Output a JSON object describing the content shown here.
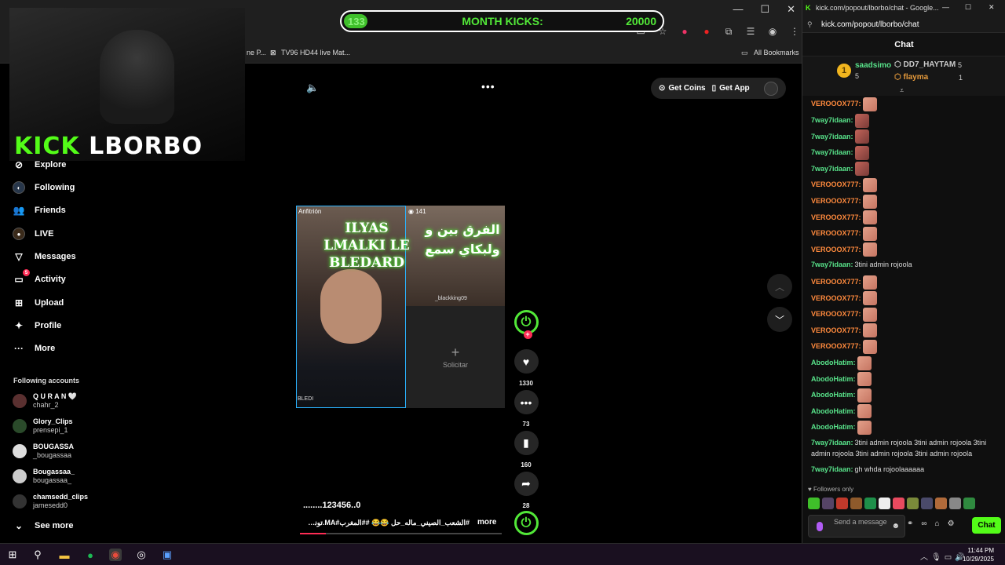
{
  "browser": {
    "bookmarks": [
      "ne P...",
      "TV96 HD44 live Mat...",
      "All Bookmarks"
    ],
    "window_controls": [
      "—",
      "☐",
      "✕"
    ]
  },
  "kick_counter": {
    "current": "133",
    "label": "MONTH KICKS:",
    "goal": "20000",
    "progress_fraction": 0.0067
  },
  "stream_logo": {
    "kick": "KICK",
    "name": "LBORBO"
  },
  "sidebar": {
    "items": [
      {
        "label": "Explore",
        "icon": "compass-icon"
      },
      {
        "label": "Following",
        "icon": "following-icon"
      },
      {
        "label": "Friends",
        "icon": "friends-icon"
      },
      {
        "label": "LIVE",
        "icon": "live-icon"
      },
      {
        "label": "Messages",
        "icon": "messages-icon"
      },
      {
        "label": "Activity",
        "icon": "activity-icon",
        "badge": "5"
      },
      {
        "label": "Upload",
        "icon": "upload-icon"
      },
      {
        "label": "Profile",
        "icon": "profile-icon"
      },
      {
        "label": "More",
        "icon": "more-icon"
      }
    ],
    "following_title": "Following accounts",
    "accounts": [
      {
        "name": "Q U R A N 🤍",
        "handle": "chahr_2"
      },
      {
        "name": "Glory_Clips",
        "handle": "prensepi_1"
      },
      {
        "name": "BOUGASSA",
        "handle": "_bougassaa"
      },
      {
        "name": "Bougassaa_",
        "handle": "bougassaa_"
      },
      {
        "name": "chamsedd_clips",
        "handle": "jamesedd0"
      }
    ],
    "see_more": "See more"
  },
  "top_pill": {
    "coins": "Get Coins",
    "app": "Get App"
  },
  "video": {
    "host_label": "Anfitrión",
    "viewers": "141",
    "overlay_title": "ILYAS LMALKI LE BLEDARD",
    "overlay_arabic": "الفرق بين و ولبكاي سمع",
    "guest_name": "_blackking09",
    "host_name": "BLEDI",
    "request_label": "Solicitar"
  },
  "actions": {
    "likes": "1330",
    "comments": "73",
    "saves": "160",
    "shares": "28"
  },
  "caption": {
    "user": "........123456..0",
    "tags": "#الشعب_الصيني_ماله_حل 😂😂 ##المغرب#MA.تونس...",
    "more": "more",
    "progress_fraction": 0.13
  },
  "chat_window": {
    "title": "kick.com/popout/lborbo/chat - Google...",
    "url": "kick.com/popout/lborbo/chat",
    "header": "Chat",
    "leaderboard": {
      "first": {
        "name": "saadsimo",
        "count": "5",
        "rank": "1"
      },
      "second": {
        "name": "DD7_HAYTAM",
        "count": "5"
      },
      "third": {
        "name": "flayma",
        "count": "1"
      }
    },
    "messages": [
      {
        "user": "VEROOOX777:",
        "color": "#ff8a3d",
        "text": "",
        "emote": "thumb"
      },
      {
        "user": "7way7idaan:",
        "color": "#58e38a",
        "text": "",
        "emote": "face"
      },
      {
        "user": "7way7idaan:",
        "color": "#58e38a",
        "text": "",
        "emote": "face"
      },
      {
        "user": "7way7idaan:",
        "color": "#58e38a",
        "text": "",
        "emote": "face"
      },
      {
        "user": "7way7idaan:",
        "color": "#58e38a",
        "text": "",
        "emote": "face"
      },
      {
        "user": "VEROOOX777:",
        "color": "#ff8a3d",
        "text": "",
        "emote": "thumb"
      },
      {
        "user": "VEROOOX777:",
        "color": "#ff8a3d",
        "text": "",
        "emote": "thumb"
      },
      {
        "user": "VEROOOX777:",
        "color": "#ff8a3d",
        "text": "",
        "emote": "thumb"
      },
      {
        "user": "VEROOOX777:",
        "color": "#ff8a3d",
        "text": "",
        "emote": "thumb"
      },
      {
        "user": "VEROOOX777:",
        "color": "#ff8a3d",
        "text": "",
        "emote": "thumb"
      },
      {
        "user": "7way7idaan:",
        "color": "#58e38a",
        "text": "3tini admin rojoola",
        "emote": ""
      },
      {
        "user": "VEROOOX777:",
        "color": "#ff8a3d",
        "text": "",
        "emote": "thumb"
      },
      {
        "user": "VEROOOX777:",
        "color": "#ff8a3d",
        "text": "",
        "emote": "thumb"
      },
      {
        "user": "VEROOOX777:",
        "color": "#ff8a3d",
        "text": "",
        "emote": "thumb"
      },
      {
        "user": "VEROOOX777:",
        "color": "#ff8a3d",
        "text": "",
        "emote": "thumb"
      },
      {
        "user": "VEROOOX777:",
        "color": "#ff8a3d",
        "text": "",
        "emote": "thumb"
      },
      {
        "user": "AbodoHatim:",
        "color": "#58e38a",
        "text": "",
        "emote": "thumb"
      },
      {
        "user": "AbodoHatim:",
        "color": "#58e38a",
        "text": "",
        "emote": "thumb"
      },
      {
        "user": "AbodoHatim:",
        "color": "#58e38a",
        "text": "",
        "emote": "thumb"
      },
      {
        "user": "AbodoHatim:",
        "color": "#58e38a",
        "text": "",
        "emote": "thumb"
      },
      {
        "user": "AbodoHatim:",
        "color": "#58e38a",
        "text": "",
        "emote": "thumb"
      },
      {
        "user": "7way7idaan:",
        "color": "#58e38a",
        "text": "3tini admin rojoola 3tini admin rojoola 3tini admin rojoola 3tini admin rojoola 3tini admin rojoola",
        "emote": ""
      },
      {
        "user": "7way7idaan:",
        "color": "#58e38a",
        "text": "gh whda rojoolaaaaaa",
        "emote": ""
      }
    ],
    "followers_only": "Followers only",
    "input_placeholder": "Send a message",
    "send_label": "Chat"
  },
  "taskbar": {
    "time": "11:44 PM",
    "date": "10/29/2025"
  },
  "colors": {
    "kick_green": "#53fc18",
    "tiktok_red": "#fe2c55"
  }
}
